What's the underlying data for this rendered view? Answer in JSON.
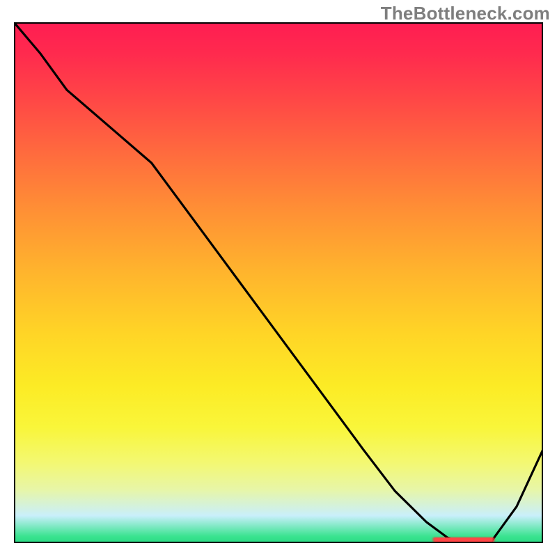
{
  "watermark": "TheBottleneck.com",
  "chart_data": {
    "type": "line",
    "title": "",
    "xlabel": "",
    "ylabel": "",
    "xlim": [
      0,
      100
    ],
    "ylim": [
      0,
      100
    ],
    "grid": false,
    "series": [
      {
        "name": "curve",
        "x": [
          0,
          5,
          10,
          18,
          26,
          34,
          42,
          50,
          58,
          66,
          72,
          78,
          82,
          86,
          90,
          95,
          100
        ],
        "y": [
          100,
          94,
          87,
          80,
          73,
          62,
          51,
          40,
          29,
          18,
          10,
          4,
          1,
          0,
          0,
          7,
          18
        ]
      }
    ],
    "annotations": [
      {
        "kind": "highlight-band",
        "x_start": 79,
        "x_end": 91,
        "y": 0
      }
    ],
    "background_gradient": {
      "top_color": "#ff1d52",
      "mid_color": "#ffd526",
      "bottom_color": "#2fdc87"
    }
  }
}
